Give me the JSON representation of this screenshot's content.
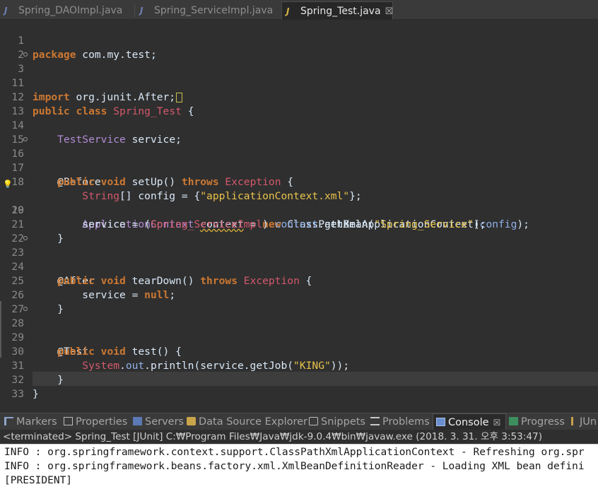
{
  "tabs": [
    {
      "label": "Spring_DAOImpl.java",
      "icon": "java-file-icon",
      "active": false
    },
    {
      "label": "Spring_ServiceImpl.java",
      "icon": "java-file-icon",
      "active": false
    },
    {
      "label": "Spring_Test.java",
      "icon": "java-test-file-icon",
      "active": true,
      "close": "☒"
    }
  ],
  "editor": {
    "line_numbers": [
      "1",
      "2",
      "3",
      "11",
      "12",
      "13",
      "14",
      "15",
      "16",
      "17",
      "18",
      "19",
      "20",
      "21",
      "22",
      "23",
      "24",
      "25",
      "26",
      "27",
      "28",
      "29",
      "30",
      "31",
      "32",
      "33"
    ],
    "lines": {
      "l1a": "package",
      "l1b": " com.my.test;",
      "l3a": "import",
      "l3b": " org.junit.After;",
      "l12a": "public",
      "l12b": "class",
      "l12c": "Spring_Test",
      "l12d": " {",
      "l14a": "TestService",
      "l14b": " service;",
      "l16": "@Before",
      "l17a": "public",
      "l17b": "void",
      "l17c": " setUp() ",
      "l17d": "throws",
      "l17e": "Exception",
      "l17f": " {",
      "l18a": "String",
      "l18b": "[] config = {",
      "l18c": "\"applicationContext.xml\"",
      "l18d": "};",
      "l19a": "ApplicationContext",
      "l19b": "context",
      "l19c": " = ",
      "l19d": "new",
      "l19e": " ClassPathXmlApplicationContext(",
      "l19f": "config",
      "l19g": ");",
      "l20a": "service = (",
      "l20b": "Spring_ServiceImpl",
      "l20c": ") ",
      "l20d": "context",
      "l20e": ".getBean(",
      "l20f": "\"Spring_Service\"",
      "l20g": ");",
      "l21": "}",
      "l23": "@After",
      "l24a": "public",
      "l24b": "void",
      "l24c": " tearDown() ",
      "l24d": "throws",
      "l24e": "Exception",
      "l24f": " {",
      "l25a": "service = ",
      "l25b": "null",
      "l25c": ";",
      "l26": "}",
      "l28": "@Test",
      "l29a": "public",
      "l29b": "void",
      "l29c": " test() {",
      "l30a": "System",
      "l30b": ".",
      "l30c": "out",
      "l30d": ".println(service.getJob(",
      "l30e": "\"KING\"",
      "l30f": "));",
      "l31": "}",
      "l32": "}"
    }
  },
  "views": [
    {
      "label": "Markers",
      "icon": "markers-icon"
    },
    {
      "label": "Properties",
      "icon": "properties-icon"
    },
    {
      "label": "Servers",
      "icon": "servers-icon"
    },
    {
      "label": "Data Source Explorer",
      "icon": "data-source-icon"
    },
    {
      "label": "Snippets",
      "icon": "snippets-icon"
    },
    {
      "label": "Problems",
      "icon": "problems-icon"
    },
    {
      "label": "Console",
      "icon": "console-icon",
      "active": true,
      "close": "☒"
    },
    {
      "label": "Progress",
      "icon": "progress-icon"
    },
    {
      "label": "JUn",
      "icon": "junit-icon"
    }
  ],
  "console": {
    "status": "<terminated> Spring_Test [JUnit] C:₩Program Files₩Java₩jdk-9.0.4₩bin₩javaw.exe (2018. 3. 31. 오후 3:53:47)",
    "lines": [
      "INFO : org.springframework.context.support.ClassPathXmlApplicationContext - Refreshing org.spr",
      "INFO : org.springframework.beans.factory.xml.XmlBeanDefinitionReader - Loading XML bean defini",
      "[PRESIDENT]"
    ]
  },
  "colors": {
    "keyword": "#cc7832",
    "class": "#d2596c",
    "type": "#b28bd6",
    "string": "#e8c34a",
    "field": "#8fb0e8",
    "background": "#2f2f2f"
  }
}
